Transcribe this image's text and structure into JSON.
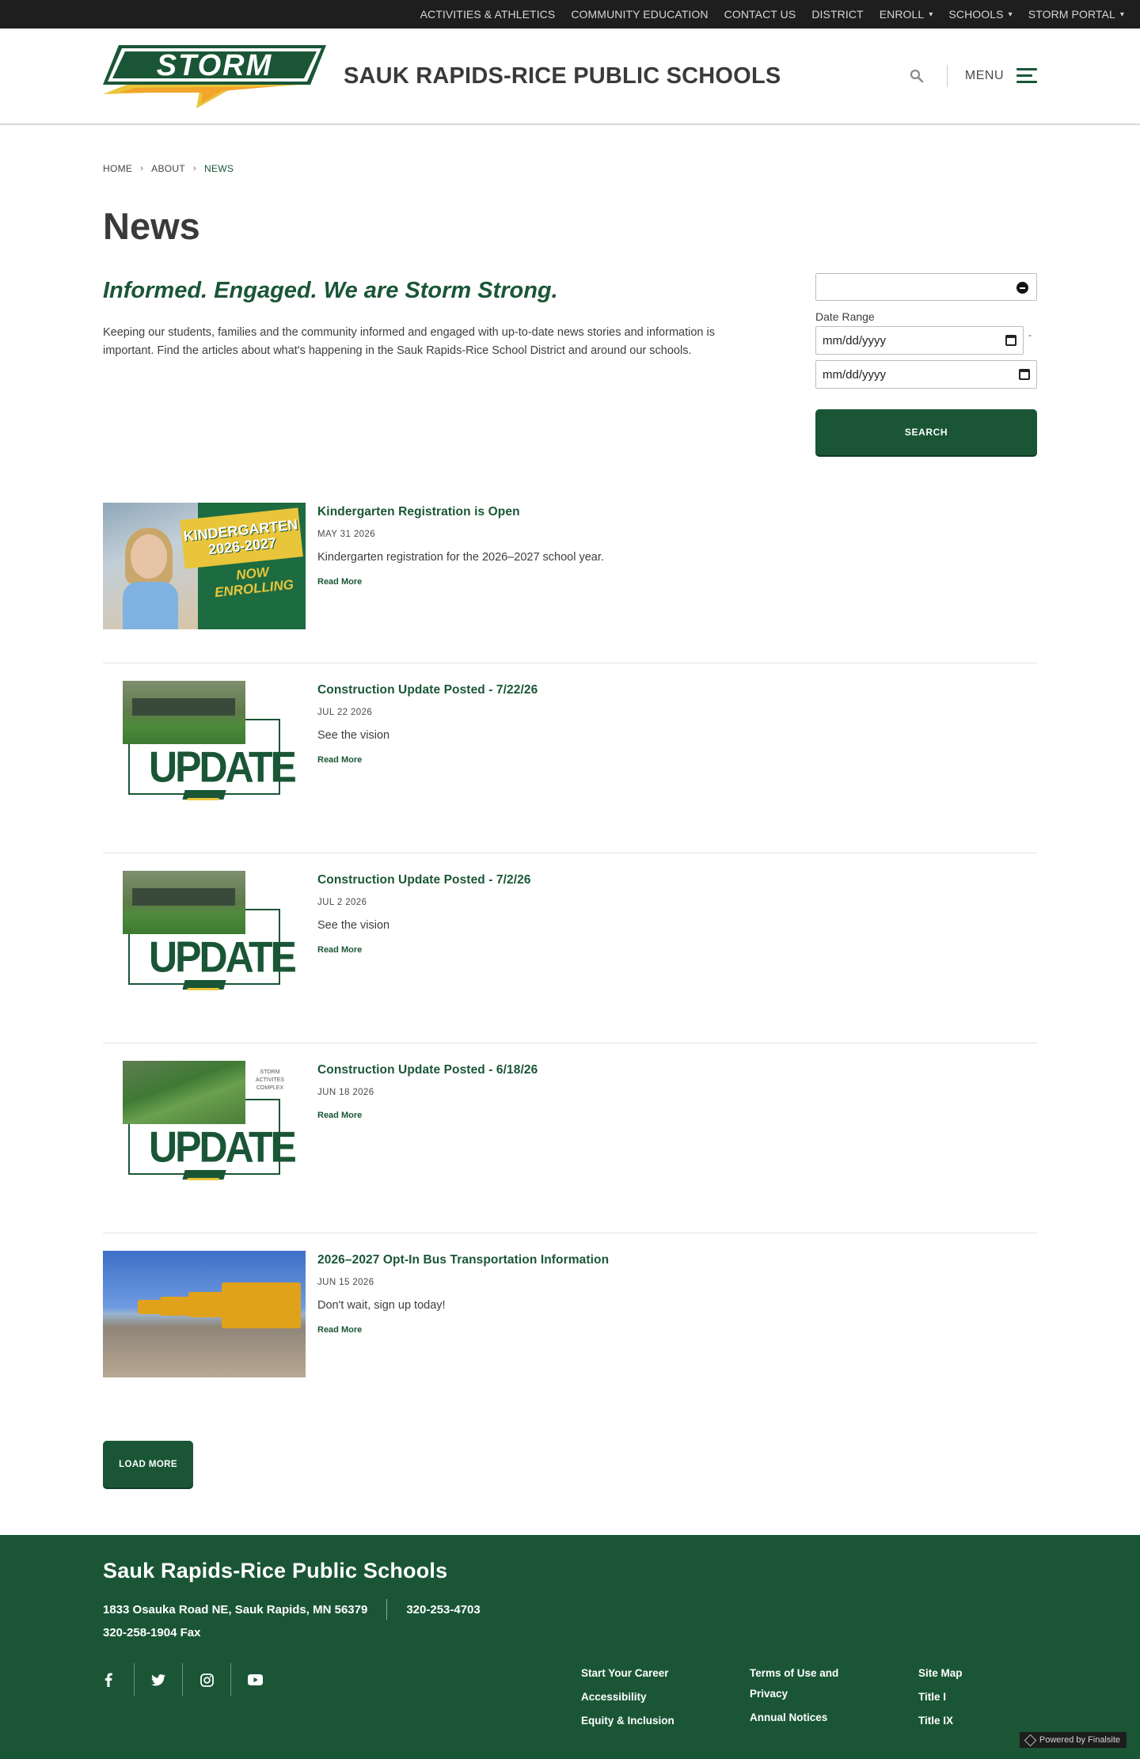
{
  "utility_nav": [
    {
      "label": "ACTIVITIES & ATHLETICS",
      "has_dropdown": false
    },
    {
      "label": "COMMUNITY EDUCATION",
      "has_dropdown": false
    },
    {
      "label": "CONTACT US",
      "has_dropdown": false
    },
    {
      "label": "DISTRICT",
      "has_dropdown": false
    },
    {
      "label": "ENROLL",
      "has_dropdown": true
    },
    {
      "label": "SCHOOLS",
      "has_dropdown": true
    },
    {
      "label": "STORM PORTAL",
      "has_dropdown": true
    }
  ],
  "header": {
    "logo_text": "STORM",
    "school_name": "SAUK RAPIDS-RICE PUBLIC SCHOOLS",
    "menu_label": "MENU",
    "icons": {
      "search": "search-icon",
      "menu": "hamburger-icon"
    }
  },
  "breadcrumb": [
    {
      "label": "HOME"
    },
    {
      "label": "ABOUT"
    },
    {
      "label": "NEWS"
    }
  ],
  "page": {
    "title": "News",
    "tagline": "Informed. Engaged. We are Storm Strong.",
    "description": "Keeping our students, families and the community informed and engaged with up-to-date news stories and information is important. Find the articles about what's happening in the Sauk Rapids-Rice School District and around our schools."
  },
  "filters": {
    "date_range_label": "Date Range",
    "start_date_placeholder": "mm/dd/yyyy",
    "end_date_placeholder": "mm/dd/yyyy",
    "range_separator": "-",
    "search_label": "SEARCH"
  },
  "news": [
    {
      "title": "Kindergarten Registration is Open",
      "date": "MAY 31 2026",
      "summary": "Kindergarten registration for the 2026–2027 school year.",
      "read_more": "Read More",
      "thumb": {
        "type": "kindergarten",
        "banner_line1": "KINDERGARTEN",
        "banner_line2": "2026-2027",
        "now_line1": "NOW",
        "now_line2": "ENROLLING"
      }
    },
    {
      "title": "Construction Update Posted - 7/22/26",
      "date": "JUL 22 2026",
      "summary": "See the vision",
      "read_more": "Read More",
      "thumb": {
        "type": "update",
        "word": "UPDATE"
      }
    },
    {
      "title": "Construction Update Posted - 7/2/26",
      "date": "JUL 2 2026",
      "summary": "See the vision",
      "read_more": "Read More",
      "thumb": {
        "type": "update",
        "word": "UPDATE"
      }
    },
    {
      "title": "Construction Update Posted - 6/18/26",
      "date": "JUN 18 2026",
      "summary": "",
      "read_more": "Read More",
      "thumb": {
        "type": "update-field",
        "word": "UPDATE",
        "side_text": "STORM ACTIVITES COMPLEX"
      }
    },
    {
      "title": "2026–2027 Opt-In Bus Transportation Information",
      "date": "JUN 15 2026",
      "summary": "Don't wait, sign up today!",
      "read_more": "Read More",
      "thumb": {
        "type": "bus"
      }
    }
  ],
  "load_more_label": "LOAD MORE",
  "footer": {
    "name": "Sauk Rapids-Rice Public Schools",
    "address": "1833 Osauka Road NE, Sauk Rapids, MN 56379",
    "phone": "320-253-4703",
    "fax": "320-258-1904 Fax",
    "socials": [
      "facebook-icon",
      "twitter-icon",
      "instagram-icon",
      "youtube-icon"
    ],
    "link_columns": [
      [
        "Start Your Career",
        "Accessibility",
        "Equity & Inclusion"
      ],
      [
        "Terms of Use and Privacy",
        "Annual Notices"
      ],
      [
        "Site Map",
        "Title I",
        "Title IX"
      ]
    ],
    "powered_by": "Powered by Finalsite"
  },
  "colors": {
    "brand_green": "#1a5636",
    "accent_yellow": "#e9c53b",
    "utility_bar": "#1e1e1e"
  }
}
